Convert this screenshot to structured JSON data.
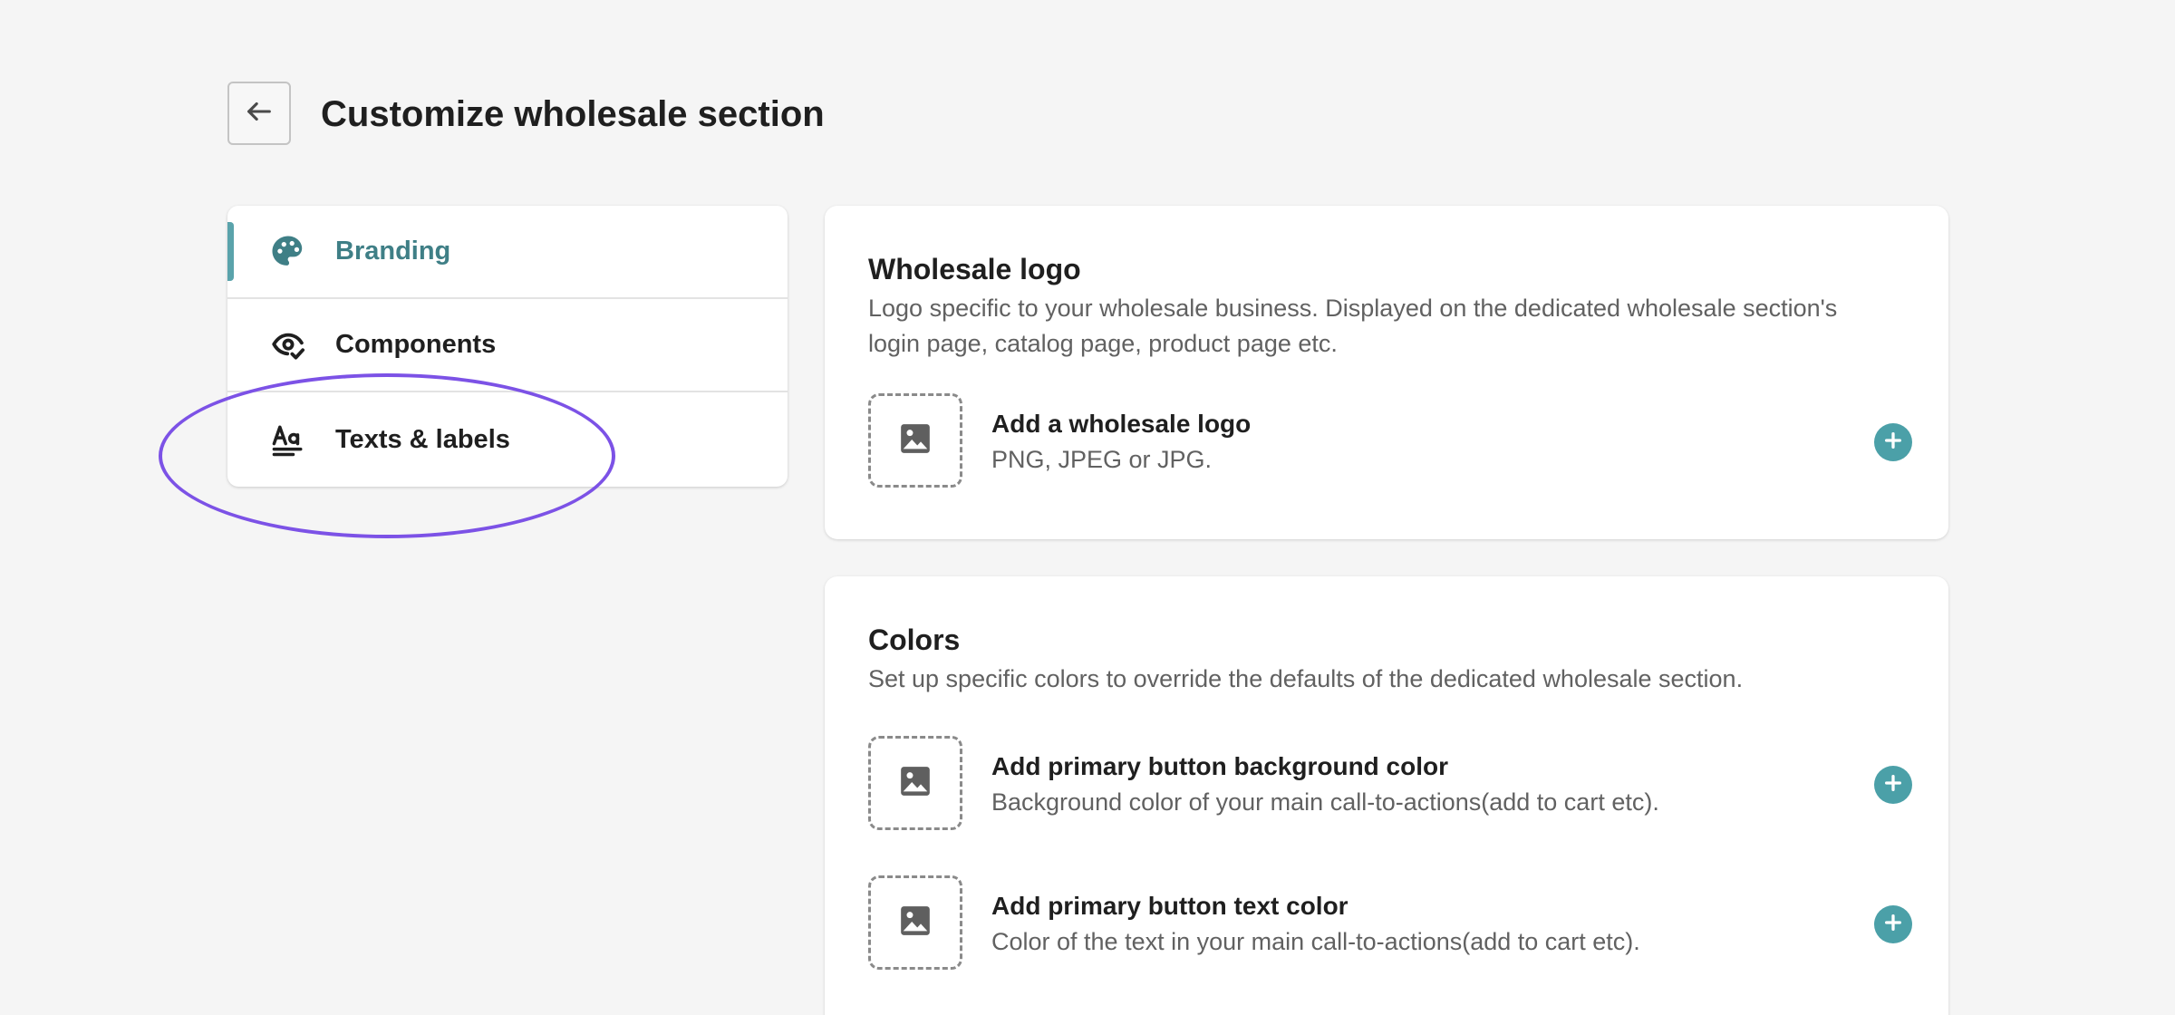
{
  "header": {
    "title": "Customize wholesale section",
    "back_icon": "arrow-left-icon"
  },
  "sidebar": {
    "items": [
      {
        "label": "Branding",
        "icon": "palette-icon",
        "active": true
      },
      {
        "label": "Components",
        "icon": "eye-check-icon",
        "active": false
      },
      {
        "label": "Texts & labels",
        "icon": "text-type-icon",
        "active": false
      }
    ]
  },
  "logo_section": {
    "title": "Wholesale logo",
    "description": "Logo specific to your wholesale business. Displayed on the dedicated wholesale section's login page, catalog page, product page etc.",
    "items": [
      {
        "title": "Add a wholesale logo",
        "description": "PNG, JPEG or JPG."
      }
    ]
  },
  "colors_section": {
    "title": "Colors",
    "description": "Set up specific colors to override the defaults of the dedicated wholesale section.",
    "items": [
      {
        "title": "Add primary button background color",
        "description": "Background color of your main call-to-actions(add to cart etc)."
      },
      {
        "title": "Add primary button text color",
        "description": "Color of the text in your main call-to-actions(add to cart etc)."
      }
    ]
  },
  "colors": {
    "accent": "#4ba0a8",
    "active_text": "#3f7f86",
    "highlight": "#7c52e6",
    "background": "#f5f5f5"
  }
}
